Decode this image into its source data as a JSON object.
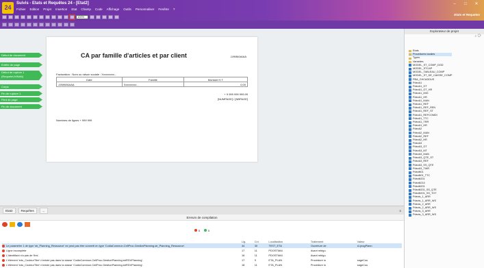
{
  "window": {
    "title": "Suivis - Etats et Requêtes 24 - [Etat2]",
    "app_name": "Etats et Requetes",
    "menu": [
      "Fichier",
      "Edition",
      "Projet",
      "Insertion",
      "Etat",
      "Champ",
      "Code",
      "Affichage",
      "Outils",
      "Personnaliser",
      "Fenêtre",
      "?"
    ],
    "zoom": "100%"
  },
  "bands": [
    {
      "label": "Début de document",
      "color": "#3fba56"
    },
    {
      "label": "Entête de page",
      "color": "#3fba56"
    },
    {
      "label": "Début de rupture 1 (RequeteLH/NbN)",
      "color": "#3fba56"
    },
    {
      "label": "Corps",
      "color": "#3fba56"
    },
    {
      "label": "Fin de rupture 1",
      "color": "#3fba56"
    },
    {
      "label": "Pied de page",
      "color": "#3fba56"
    },
    {
      "label": "Fin de document",
      "color": "#3fba56"
    }
  ],
  "report": {
    "title": "CA par famille d'articles et par client",
    "date": "JJ/MM/AAAA",
    "facturation": "Facturation : Nom ou raison sociale : Xxxxxxxxx...",
    "columns": [
      "Date",
      "Famille",
      "Montant H.T."
    ],
    "row": {
      "date": "JJ/MM/AAAA",
      "famille": "Xxxxxxxxx...",
      "montant": "0,00"
    },
    "total": "+ 9 999 999 999,99",
    "page": "[NUMPAGE] / [NBPAGE]",
    "nb_lignes_label": "Nombres de lignes",
    "nb_lignes_value": "+ 999 999"
  },
  "explorer": {
    "title": "Explorateur de projet",
    "items": [
      "Etats",
      "Procédures locales",
      "Types",
      "Variables",
      "MODEL_ST_COMP_DGD",
      "MODEL_STCAP",
      "MODEL_TABLEAU_COMP",
      "MODEL_ST_DE_CAISSE_COMP",
      "PBA_CHCADDUS",
      "PdevA1",
      "PdevA1_GT",
      "PdevA1_GT_HR",
      "PdevA1_IMG",
      "PdevA1_HR",
      "PdevA1_MAN",
      "PdevA1_REF",
      "PdevA1_REF_REN",
      "PdevA1_REF_ST",
      "PdevA1_REFCOMDI",
      "PdevA1_TTC",
      "PdevA1_TRR",
      "PdevA1_HR",
      "PdevA2",
      "PdevA2_MAN",
      "PdevA2_REF",
      "PdevA2_HR",
      "PdevA3",
      "PdevA3_GT",
      "PdevA3_MT",
      "PdevA3_MAN",
      "PdevA3_QTE_ST",
      "PdevA3_REF",
      "PdevA3_SS_QTE",
      "PdevA3_TWR",
      "Pdevlit01",
      "Pdevlit01_TTC",
      "Pdevlit201",
      "Pdevlit210",
      "Pdevlit201",
      "Pdevlit201_SS_QTE",
      "Pdevlit201_SS_TOT",
      "Pdevis_1_ARR",
      "Pdevis_1_ARR_WS",
      "Pdevis_2_ARR",
      "Pdevis_2_ARR_WS",
      "Pdevis_3_ARR",
      "Pdevis_3_ARR_WS"
    ]
  },
  "bottom": {
    "tabs": [
      "Etat2",
      "Requêtes",
      "..."
    ],
    "panel_title": "Erreurs de compilation",
    "errors_count": "5",
    "warnings_count": "0",
    "columns": [
      "",
      "Lig.",
      "Col.",
      "Localisation",
      "Traitement",
      "Valeur"
    ],
    "rows": [
      {
        "msg": "Le paramètre 1 de type 'str_Planning_Ressource' ne peut pas être converti en type 'CodiaCommun.CellProc.GestionPlanning.str_Planning_Ressource'.",
        "lig": "44",
        "col": "30",
        "loc": "TEST_ETA",
        "trait": "Ouverture de",
        "val": "st.progPlann"
      },
      {
        "msg": "Ligne incomplète",
        "lig": "17",
        "col": "11",
        "loc": "PDOSTMAI",
        "trait": "Avant relégu",
        "val": ""
      },
      {
        "msg": "L'identifiant n'a pas de 'fins'.",
        "lig": "16",
        "col": "11",
        "loc": "PDOSTMAI",
        "trait": "Avant relégu",
        "val": ""
      },
      {
        "msg": "L'élément 'edo_CouleurTitre' n'existe pas dans la classe 'CodiaCommun.CellProc.GestionPlanning.strRDVPlanning'.",
        "lig": "17",
        "col": "9",
        "loc": "ETA_PLAN",
        "trait": "Procédure lo",
        "val": "sageCou"
      },
      {
        "msg": "L'élément 'edo_CouleurTitre' n'existe pas dans la classe 'CodiaCommun.CellProc.GestionPlanning.strRDVPlanning'.",
        "lig": "18",
        "col": "11",
        "loc": "ETA_PLAN",
        "trait": "Procédure lo",
        "val": "sageCou"
      }
    ]
  }
}
